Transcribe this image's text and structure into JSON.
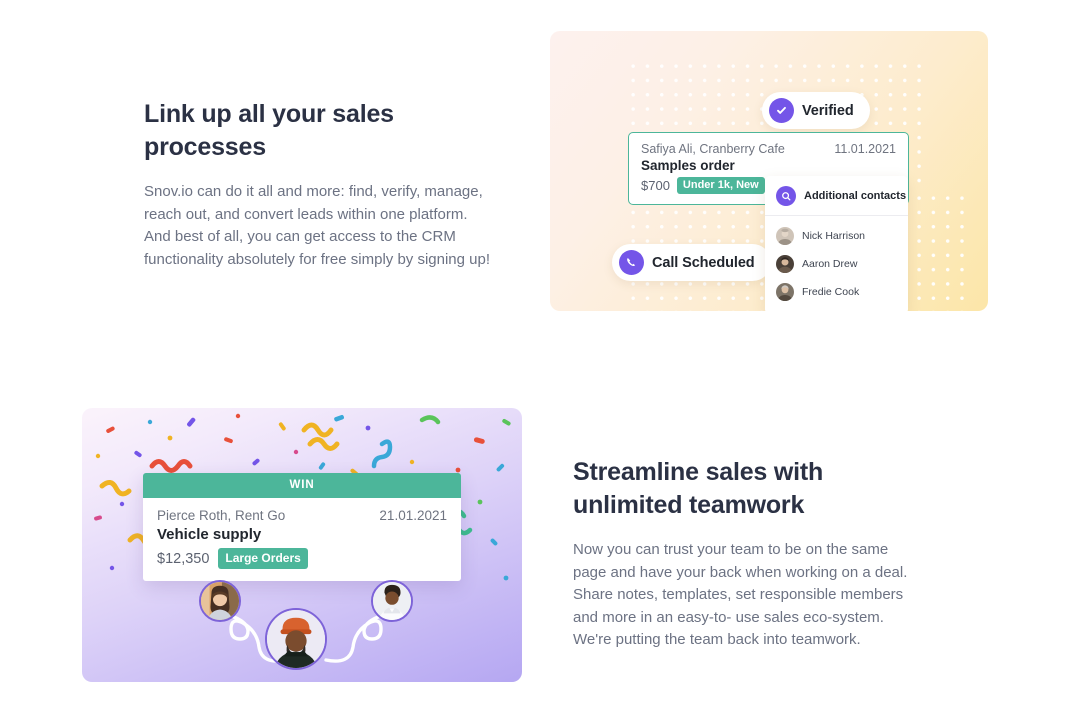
{
  "sections": [
    {
      "id": "link-up-sales",
      "title": "Link up all your sales processes",
      "body": "Snov.io can do it all and more: find, verify, manage, reach out, and convert leads within one platform. And best of all, you can get access to the CRM functionality absolutely for free simply by signing up!",
      "illustration": {
        "badges": [
          {
            "label": "Verified",
            "icon": "check-circle-icon",
            "color": "#7455e8"
          },
          {
            "label": "Call Scheduled",
            "icon": "phone-icon",
            "color": "#7455e8"
          }
        ],
        "deal_card": {
          "contact": "Safiya Ali, Cranberry Cafe",
          "date": "11.01.2021",
          "deal_name": "Samples order",
          "amount": "$700",
          "tag": "Under 1k, New",
          "accent_color": "#4cb69a"
        },
        "contacts_panel": {
          "title": "Additional contacts",
          "icon": "search-icon",
          "contacts": [
            {
              "name": "Nick Harrison"
            },
            {
              "name": "Aaron Drew"
            },
            {
              "name": "Fredie Cook"
            }
          ]
        },
        "background_gradient": [
          "#fdf1ee",
          "#fce6a8"
        ]
      }
    },
    {
      "id": "streamline-teamwork",
      "title": "Streamline sales with unlimited teamwork",
      "body": "Now you can trust your team to be on the same page and have your back when working on a deal. Share notes, templates, set responsible members and more in an easy-to- use sales eco-system. We're putting the team back into teamwork.",
      "illustration": {
        "status_header": "WIN",
        "deal_card": {
          "contact": "Pierce Roth, Rent Go",
          "date": "21.01.2021",
          "deal_name": "Vehicle supply",
          "amount": "$12,350",
          "tag": "Large Orders",
          "accent_color": "#4cb69a"
        },
        "team_avatars": [
          {
            "position": "left"
          },
          {
            "position": "center"
          },
          {
            "position": "right"
          }
        ],
        "background_gradient": [
          "#fbf3fb",
          "#b5a7f2"
        ]
      }
    }
  ]
}
